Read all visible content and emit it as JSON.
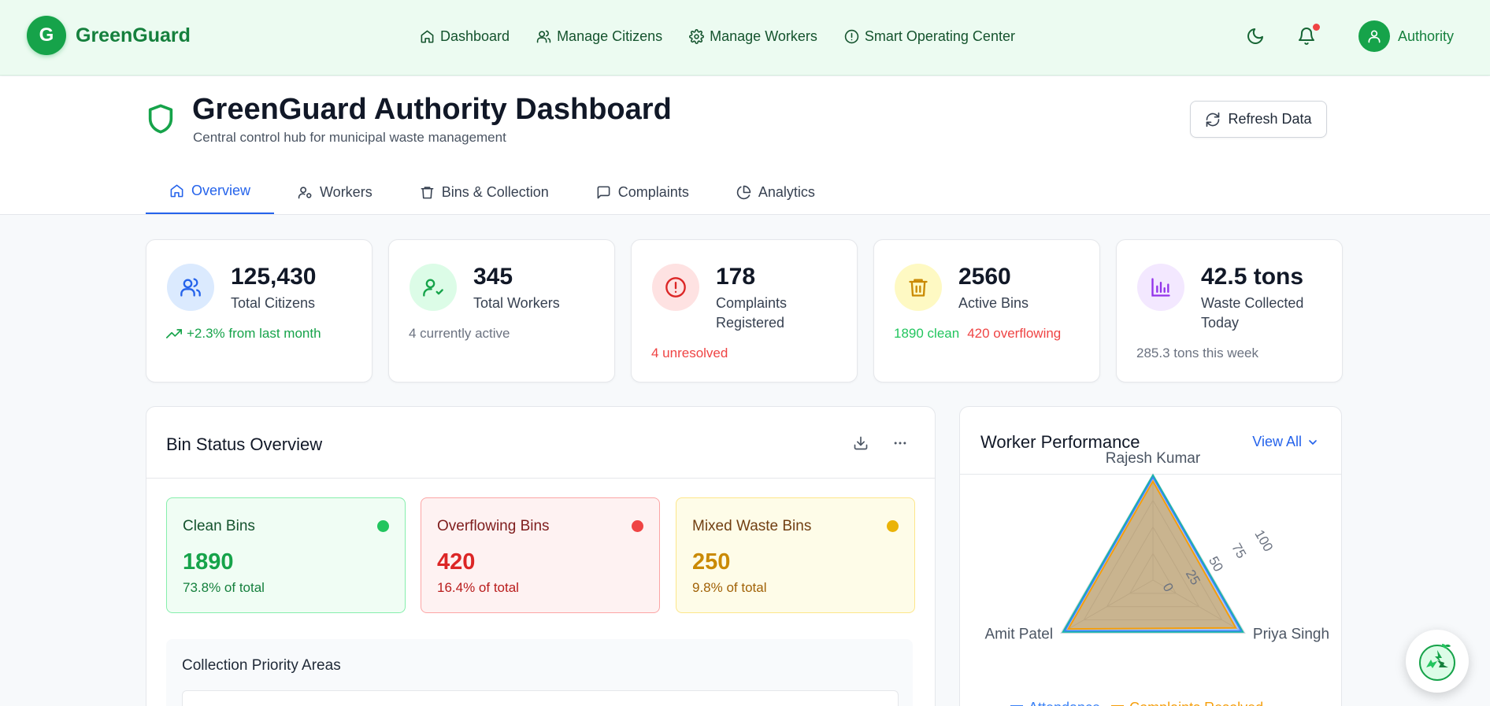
{
  "brand": {
    "initial": "G",
    "name": "GreenGuard"
  },
  "nav": {
    "links": [
      "Dashboard",
      "Manage Citizens",
      "Manage Workers",
      "Smart Operating Center"
    ],
    "user": "Authority"
  },
  "header": {
    "title": "GreenGuard Authority Dashboard",
    "subtitle": "Central control hub for municipal waste management",
    "refresh": "Refresh Data"
  },
  "tabs": [
    "Overview",
    "Workers",
    "Bins & Collection",
    "Complaints",
    "Analytics"
  ],
  "stats": [
    {
      "value": "125,430",
      "label": "Total Citizens",
      "foot": "+2.3% from last month"
    },
    {
      "value": "345",
      "label": "Total Workers",
      "foot": "4 currently active"
    },
    {
      "value": "178",
      "label": "Complaints Registered",
      "foot": "4 unresolved"
    },
    {
      "value": "2560",
      "label": "Active Bins",
      "foot_clean": "1890 clean",
      "foot_over": "420 overflowing"
    },
    {
      "value": "42.5 tons",
      "label": "Waste Collected Today",
      "foot": "285.3 tons this week"
    }
  ],
  "bin_status": {
    "title": "Bin Status Overview",
    "cards": [
      {
        "label": "Clean Bins",
        "value": "1890",
        "pct": "73.8% of total"
      },
      {
        "label": "Overflowing Bins",
        "value": "420",
        "pct": "16.4% of total"
      },
      {
        "label": "Mixed Waste Bins",
        "value": "250",
        "pct": "9.8% of total"
      }
    ],
    "priority_title": "Collection Priority Areas"
  },
  "worker_performance": {
    "title": "Worker Performance",
    "view_all": "View All",
    "radar_labels": [
      "Rajesh Kumar",
      "Priya Singh",
      "Amit Patel"
    ],
    "radar_ticks": [
      "100",
      "75",
      "50",
      "25",
      "0"
    ],
    "legend": [
      "Attendance",
      "Complaints Resolved"
    ]
  },
  "colors": {
    "brand_green": "#16a34a",
    "accent_blue": "#2563eb",
    "danger_red": "#ef4444",
    "warning_amber": "#ca8a04"
  },
  "chart_data": {
    "type": "radar",
    "categories": [
      "Rajesh Kumar",
      "Priya Singh",
      "Amit Patel"
    ],
    "rlim": [
      0,
      100
    ],
    "ticks": [
      0,
      25,
      50,
      75,
      100
    ],
    "series": [
      {
        "name": "Attendance",
        "values": [
          97,
          96,
          96
        ],
        "color": "#3b82f6"
      },
      {
        "name": "Complaints Resolved",
        "values": [
          93,
          90,
          92
        ],
        "color": "#f59e0b"
      }
    ]
  }
}
